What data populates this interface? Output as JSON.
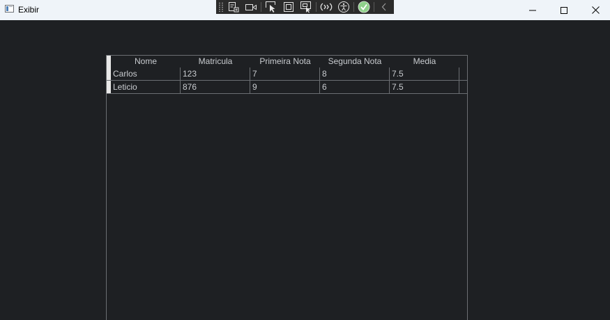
{
  "window": {
    "title": "Exibir",
    "controls": {
      "minimize_icon": "minimize-icon",
      "maximize_icon": "maximize-icon",
      "close_icon": "close-icon"
    }
  },
  "debug_toolbar": {
    "tools": [
      "go-to-live-visual-tree-icon",
      "record-icon",
      "select-element-icon",
      "display-layout-adorners-icon",
      "track-focused-element-icon",
      "hot-reload-icon",
      "accessibility-icon",
      "check-icon",
      "collapse-icon"
    ]
  },
  "grid": {
    "columns": [
      "Nome",
      "Matricula",
      "Primeira Nota",
      "Segunda Nota",
      "Media"
    ],
    "rows": [
      {
        "nome": "Carlos",
        "matricula": "123",
        "primeira_nota": "7",
        "segunda_nota": "8",
        "media": "7.5"
      },
      {
        "nome": "Leticio",
        "matricula": "876",
        "primeira_nota": "9",
        "segunda_nota": "6",
        "media": "7.5"
      }
    ]
  },
  "colors": {
    "background": "#1e2023",
    "titlebar": "#eff4f9",
    "grid_line": "#6c6f73",
    "text": "#c9ccd0",
    "toolbar": "#2b2b2b",
    "check_accent": "#8fd18b"
  }
}
